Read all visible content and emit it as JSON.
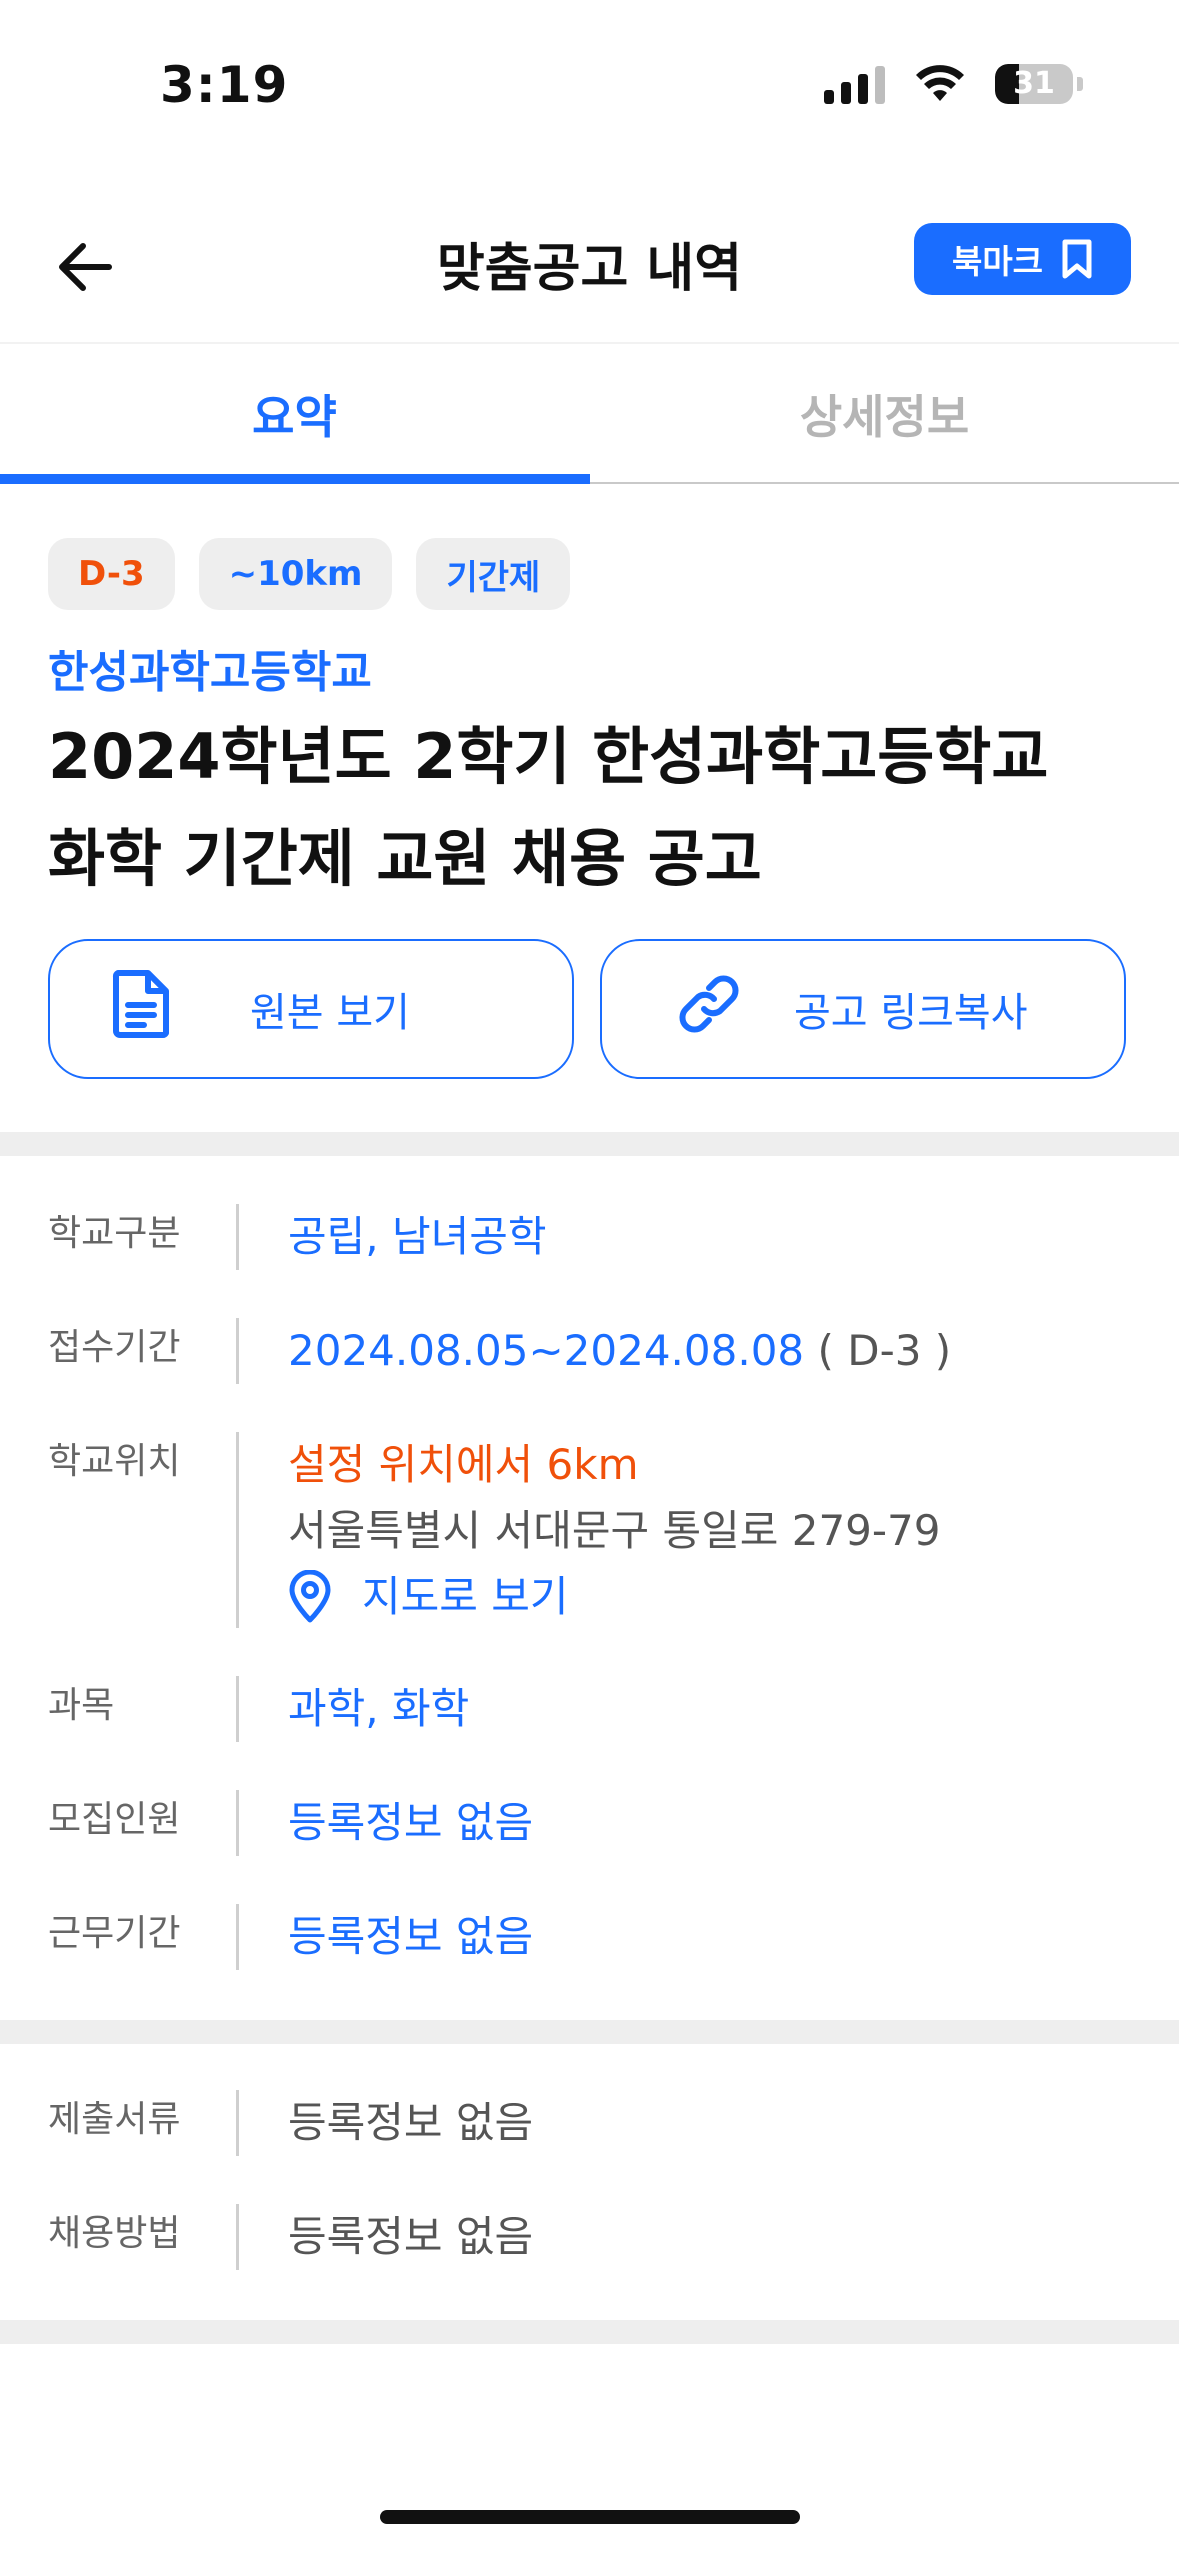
{
  "status_bar": {
    "time": "3:19",
    "battery": "31",
    "battery_level": 0.31
  },
  "header": {
    "title": "맞춤공고 내역",
    "bookmark_label": "북마크"
  },
  "tabs": [
    {
      "label": "요약",
      "active": true
    },
    {
      "label": "상세정보",
      "active": false
    }
  ],
  "summary": {
    "chips": [
      "D-3",
      "~10km",
      "기간제"
    ],
    "school": "한성과학고등학교",
    "title_line1": "2024학년도 2학기 한성과학고등학교",
    "title_line2": "화학 기간제 교원 채용 공고",
    "view_original_label": "원본 보기",
    "copy_link_label": "공고 링크복사"
  },
  "info": {
    "school_type": {
      "label": "학교구분",
      "value": "공립, 남녀공학"
    },
    "reception": {
      "label": "접수기간",
      "value": "2024.08.05~2024.08.08",
      "dday": "( D-3 )"
    },
    "location": {
      "label": "학교위치",
      "distance": "설정 위치에서 6km",
      "address": "서울특별시 서대문구 통일로 279-79",
      "map_label": "지도로 보기"
    },
    "subject": {
      "label": "과목",
      "value": "과학, 화학"
    },
    "recruits": {
      "label": "모집인원",
      "value": "등록정보 없음"
    },
    "work_period": {
      "label": "근무기간",
      "value": "등록정보 없음"
    },
    "documents": {
      "label": "제출서류",
      "value": "등록정보 없음"
    },
    "method": {
      "label": "채용방법",
      "value": "등록정보 없음"
    }
  },
  "colors": {
    "accent": "#1a6dff",
    "dday": "#f0500a",
    "muted": "#b5b5b5"
  }
}
